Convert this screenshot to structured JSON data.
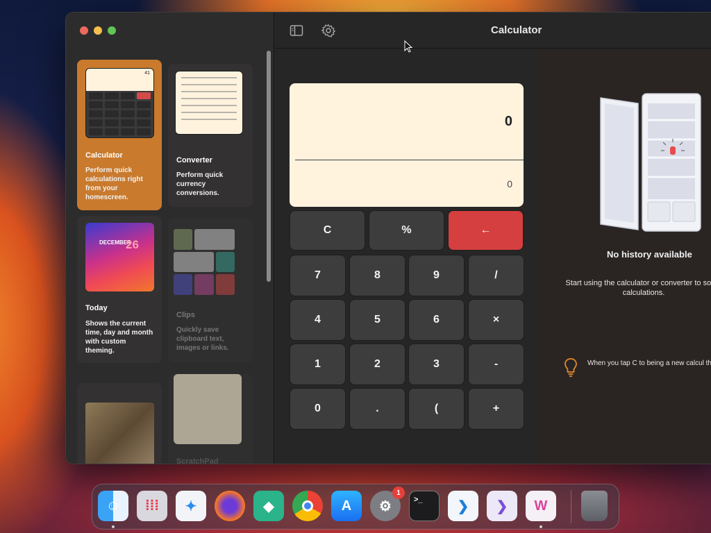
{
  "toolbar": {
    "title": "Calculator"
  },
  "sidebar": {
    "cards": [
      {
        "title": "Calculator",
        "description": "Perform quick calculations right from your homescreen.",
        "thumb_display": "41"
      },
      {
        "title": "Converter",
        "description": "Perform quick currency conversions."
      },
      {
        "title": "Today",
        "description": "Shows the current time, day and month with custom theming.",
        "thumb_month": "DECEMBER",
        "thumb_day": "26"
      },
      {
        "title": "Clips",
        "description": "Quickly save clipboard text, images or links."
      },
      {
        "title": "",
        "description": ""
      },
      {
        "title": "ScratchPad",
        "description": ""
      }
    ]
  },
  "calculator": {
    "display_value": "0",
    "display_result": "0",
    "keys": {
      "clear": "C",
      "percent": "%",
      "backspace": "←",
      "seven": "7",
      "eight": "8",
      "nine": "9",
      "divide": "/",
      "four": "4",
      "five": "5",
      "six": "6",
      "multiply": "×",
      "one": "1",
      "two": "2",
      "three": "3",
      "minus": "-",
      "zero": "0",
      "dot": ".",
      "paren": "(",
      "plus": "+"
    }
  },
  "history": {
    "empty_title": "No history available",
    "empty_desc": "Start using the calculator or converter to some calculations.",
    "tip": "When you tap C to being a new calcul the existing query will be auto-saved."
  },
  "dock": {
    "apps": [
      "Finder",
      "Launchpad",
      "Safari",
      "Firefox",
      "Quadrant",
      "Chrome",
      "App Store",
      "System Settings",
      "Terminal",
      "VS Code",
      "Visual Studio",
      "Widgets",
      "Trash"
    ],
    "settings_badge": "1"
  },
  "colors": {
    "accent": "#c97a2d",
    "backspace": "#d53f3f",
    "display_bg": "#fff3de"
  }
}
